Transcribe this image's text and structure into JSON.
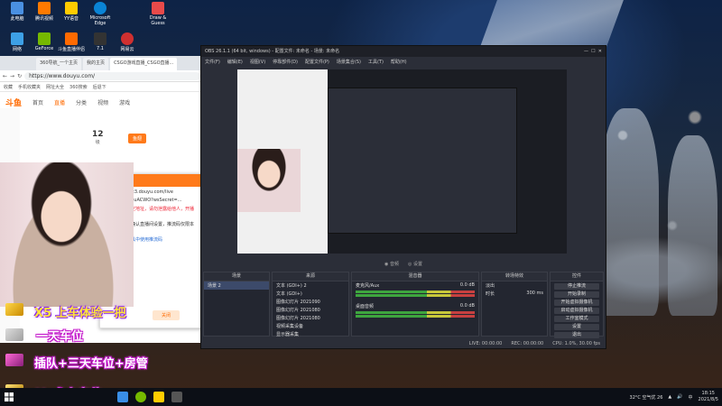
{
  "desktop": {
    "icons": [
      {
        "label": "此电脑",
        "color": "#4a90e2"
      },
      {
        "label": "腾讯视频",
        "color": "#ff7a00"
      },
      {
        "label": "YY语音",
        "color": "#ffcc00"
      },
      {
        "label": "Microsoft Edge",
        "color": "#0a84d6"
      },
      {
        "label": "Draw & Guess",
        "color": "#e84a4a"
      },
      {
        "label": "网络",
        "color": "#3da0e6"
      },
      {
        "label": "GeForce",
        "color": "#76b900"
      },
      {
        "label": "斗鱼直播伴侣",
        "color": "#ff6a00"
      },
      {
        "label": "7.1",
        "color": "#333"
      },
      {
        "label": "网易云",
        "color": "#d03030"
      }
    ]
  },
  "browser": {
    "tabs": [
      "360导航_一个主页",
      "我的主页",
      "CSGO游戏直播_CSGO直播..."
    ],
    "url": "https://www.douyu.com/",
    "bookmarks": [
      "收藏",
      "手机收藏夹",
      "网址大全",
      "360搜索",
      "后退下"
    ],
    "site": {
      "logo": "斗鱼",
      "nav": [
        "首页",
        "直播",
        "分类",
        "视频",
        "游戏"
      ],
      "stats": [
        {
          "value": "12",
          "label": "级"
        },
        {
          "value": "",
          "label": "鱼翅"
        }
      ]
    },
    "dialog": {
      "title": "直播信息",
      "server": "rtmp://sendtc3.douyu.com/live",
      "key": "9846375rTbcuACWO?wsSecret=...",
      "warning": "推流地址为固定地址，请勿泄露给他人，开播前请确认",
      "note1": "每次开播前请确认直播间设置，推流码仅限本人使用",
      "note2": "只能在直播工具中使用推流码",
      "button": "关闭"
    }
  },
  "overlay": {
    "lines": [
      "X5 上车体验一把",
      "一天车位",
      "插队+三天车位+房管",
      "V+永久车位"
    ]
  },
  "obs": {
    "title": "OBS 26.1.1 (64 bit, windows) - 配置文件: 未命名 - 场景: 未命名",
    "menu": [
      "文件(F)",
      "编辑(E)",
      "视图(V)",
      "停靠部件(D)",
      "配置文件(P)",
      "场景集合(S)",
      "工具(T)",
      "帮助(H)"
    ],
    "toolbar": [
      "◉ 音频",
      "◎ 设置"
    ],
    "docks": {
      "scenes": {
        "title": "场景",
        "items": [
          "场景 2"
        ]
      },
      "sources": {
        "title": "来源",
        "items": [
          "文本 (GDI+) 2",
          "文本 (GDI+)",
          "图像幻灯片 2021090",
          "图像幻灯片 2021080",
          "图像幻灯片 2021080",
          "视频采集设备",
          "显示器采集"
        ]
      },
      "mixer": {
        "title": "混音器",
        "channels": [
          {
            "name": "麦克风/Aux",
            "db": "0.0 dB"
          },
          {
            "name": "桌面音频",
            "db": "0.0 dB"
          }
        ]
      },
      "transitions": {
        "title": "转场特效",
        "type": "淡出",
        "duration_label": "时长",
        "duration": "300 ms"
      },
      "controls": {
        "title": "控件",
        "buttons": [
          "停止推流",
          "开始录制",
          "开始虚拟摄像机",
          "启动虚拟摄像机",
          "工作室模式",
          "设置",
          "退出"
        ]
      }
    },
    "status": {
      "live": "LIVE: 00:00:00",
      "rec": "REC: 00:00:00",
      "cpu": "CPU: 1.0%, 30.00 fps"
    }
  },
  "taskbar": {
    "weather": "32°C 空气优 26",
    "time": "18:15",
    "date": "2021/8/5"
  }
}
